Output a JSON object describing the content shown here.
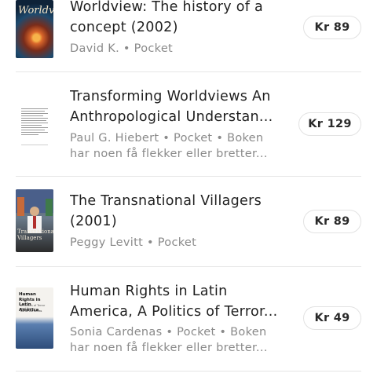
{
  "listings": [
    {
      "title_line1": "Worldview: The history of a",
      "title_line2": "concept (2002)",
      "meta_line1": "David K. • Pocket",
      "meta_line2": "",
      "price": "Kr 89",
      "cover_text": "Worldview"
    },
    {
      "title_line1": "Transforming Worldviews An",
      "title_line2": "Anthropological Understan...",
      "meta_line1": "Paul G. Hiebert • Pocket • Boken",
      "meta_line2": "har noen få flekker eller bretter...",
      "price": "Kr 129"
    },
    {
      "title_line1": "The Transnational Villagers",
      "title_line2": "(2001)",
      "meta_line1": "Peggy Levitt • Pocket",
      "meta_line2": "",
      "price": "Kr 89",
      "cover_text_1": "Transnational",
      "cover_text_2": "Villagers"
    },
    {
      "title_line1": "Human Rights in Latin",
      "title_line2": "America, A Politics of Terror...",
      "meta_line1": "Sonia Cardenas • Pocket • Boken",
      "meta_line2": "har noen få flekker eller bretter...",
      "price": "Kr 49",
      "cover_title": "Human Rights in Latin America",
      "cover_subtitle": "A Politics of Terror and Hope",
      "cover_author": "Sonia Cardenas"
    }
  ],
  "colors": {
    "title": "#1f1f1f",
    "meta": "#8a8a8a",
    "divider": "#e6e6e6",
    "price_border": "#e2e2e2"
  }
}
